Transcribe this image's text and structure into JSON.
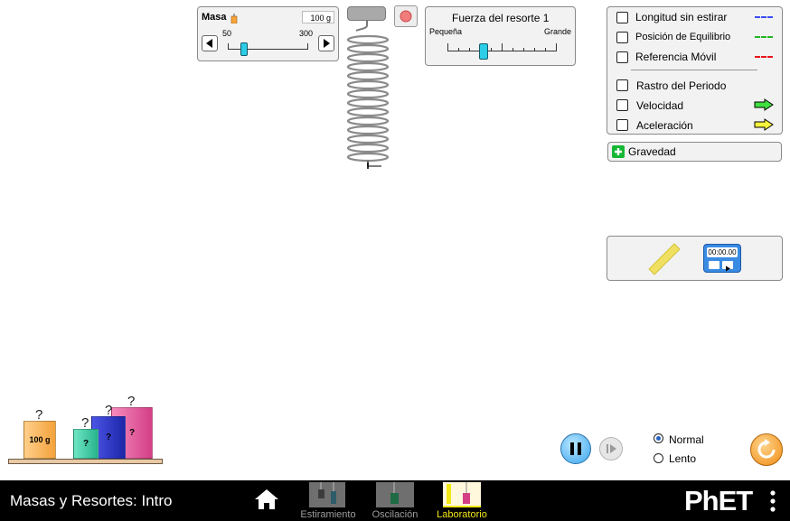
{
  "mass_panel": {
    "title": "Masa",
    "value": "100 g",
    "min_label": "50",
    "max_label": "300",
    "slider_fraction": 0.2
  },
  "spring_panel": {
    "title": "Fuerza del resorte 1",
    "min_label": "Pequeña",
    "max_label": "Grande",
    "slider_fraction": 0.33
  },
  "options": {
    "natural_length": "Longitud sin estirar",
    "equilibrium": "Posición de Equilibrio",
    "moving_reference": "Referencia Móvil",
    "period_trace": "Rastro del Periodo",
    "velocity": "Velocidad",
    "acceleration": "Aceleración"
  },
  "gravity": {
    "label": "Gravedad"
  },
  "stopwatch": {
    "time": "00:00.00"
  },
  "masses": {
    "known_label": "100 g",
    "unknown_label": "?"
  },
  "speed": {
    "normal": "Normal",
    "slow": "Lento"
  },
  "navbar": {
    "title": "Masas y Resortes: Intro",
    "screens": [
      "Estiramiento",
      "Oscilación",
      "Laboratorio"
    ],
    "brand": "PhET"
  },
  "colors": {
    "blue_line": "#3b4cf5",
    "green_line": "#23b523",
    "red_line": "#e8141a",
    "velocity_arrow": "#3fe03f",
    "acceleration_arrow": "#f6f63b",
    "selected_screen": "#f2e916"
  }
}
